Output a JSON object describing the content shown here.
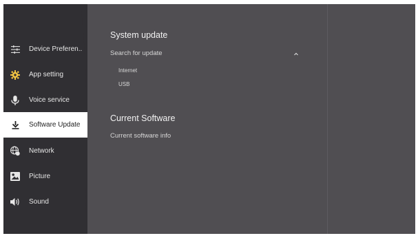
{
  "sidebar": {
    "items": [
      {
        "label": "Device Preferen..",
        "icon": "sliders-icon"
      },
      {
        "label": "App setting",
        "icon": "gear-icon"
      },
      {
        "label": "Voice service",
        "icon": "microphone-icon"
      },
      {
        "label": "Software Update",
        "icon": "download-icon",
        "active": true
      },
      {
        "label": "Network",
        "icon": "globe-icon"
      },
      {
        "label": "Picture",
        "icon": "picture-icon"
      },
      {
        "label": "Sound",
        "icon": "speaker-icon"
      }
    ]
  },
  "main": {
    "system_update": {
      "title": "System update",
      "search_label": "Search for update",
      "options": [
        "Internet",
        "USB"
      ]
    },
    "current_software": {
      "title": "Current Software",
      "info_label": "Current software info"
    }
  },
  "colors": {
    "panel_bg": "#504e52",
    "sidebar_bg": "#302f33",
    "active_bg": "#ffffff",
    "accent_gear": "#f4c542"
  }
}
